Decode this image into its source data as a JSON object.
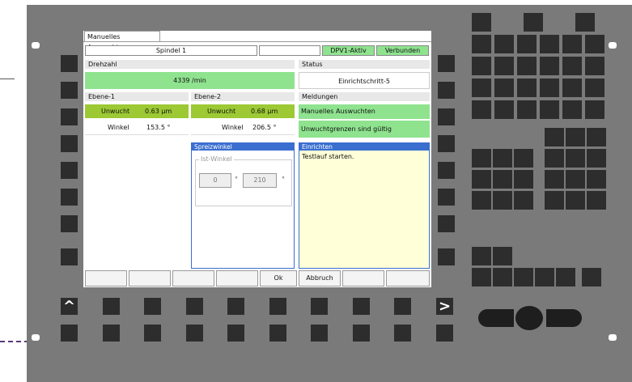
{
  "screen": {
    "tab": "Manuelles Auswuchten",
    "spindle": "Spindel 1",
    "dpv": "DPV1-Aktiv",
    "connection": "Verbunden",
    "drehzahl_label": "Drehzahl",
    "drehzahl_value": "4339 /min",
    "status_label": "Status",
    "status_value": "Einrichtschritt-5",
    "ebene1": {
      "label": "Ebene-1",
      "unwucht_label": "Unwucht",
      "unwucht_value": "0.63 µm",
      "winkel_label": "Winkel",
      "winkel_value": "153.5 °"
    },
    "ebene2": {
      "label": "Ebene-2",
      "unwucht_label": "Unwucht",
      "unwucht_value": "0.68 µm",
      "winkel_label": "Winkel",
      "winkel_value": "206.5 °"
    },
    "meldungen_label": "Meldungen",
    "meldung1": "Manuelles Auswuchten",
    "meldung2": "Unwuchtgrenzen sind gültig",
    "spreizwinkel": {
      "title": "Spreizwinkel",
      "ist_label": "Ist-Winkel",
      "value1": "0",
      "value2": "210",
      "deg": "°"
    },
    "einrichten": {
      "title": "Einrichten",
      "text": "Testlauf starten."
    },
    "buttons": {
      "ok": "Ok",
      "abbruch": "Abbruch"
    }
  },
  "keypad": {
    "up_arrow": "^",
    "right_arrow": ">"
  },
  "colors": {
    "green": "#8fe38f",
    "olive": "#9cc934",
    "blue": "#3a6fd0",
    "yellow": "#ffffd8",
    "bezel": "#7a7a7a",
    "key": "#2d2d2d"
  }
}
